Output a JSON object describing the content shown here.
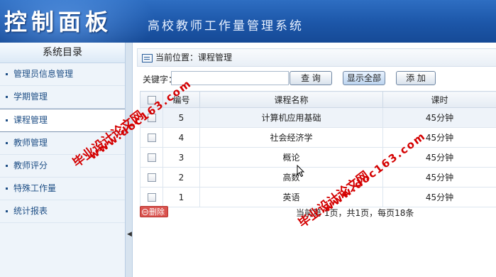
{
  "header": {
    "title": "控制面板",
    "subtitle": "高校教师工作量管理系统"
  },
  "sidebar": {
    "title": "系统目录",
    "items": [
      {
        "label": "管理员信息管理"
      },
      {
        "label": "学期管理"
      },
      {
        "label": "课程管理"
      },
      {
        "label": "教师管理"
      },
      {
        "label": "教师评分"
      },
      {
        "label": "特殊工作量"
      },
      {
        "label": "统计报表"
      }
    ]
  },
  "breadcrumb": {
    "text": "当前位置：课程管理"
  },
  "toolbar": {
    "keyword_label": "关键字：",
    "keyword_value": "",
    "search_label": "查 询",
    "show_all_label": "显示全部",
    "add_label": "添 加"
  },
  "table": {
    "headers": [
      "",
      "编号",
      "课程名称",
      "课时"
    ],
    "rows": [
      {
        "id": "5",
        "name": "计算机应用基础",
        "hours": "45分钟"
      },
      {
        "id": "4",
        "name": "社会经济学",
        "hours": "45分钟"
      },
      {
        "id": "3",
        "name": "概论",
        "hours": "45分钟"
      },
      {
        "id": "2",
        "name": "高数",
        "hours": "45分钟"
      },
      {
        "id": "1",
        "name": "英语",
        "hours": "45分钟"
      }
    ]
  },
  "delete_label": "删除",
  "pager": {
    "text": "当前第 1页，共1页，每页18条"
  },
  "watermarks": {
    "site": "www.doc163.com",
    "cn": "毕业设计论文网"
  },
  "colors": {
    "header": "#1c56a8",
    "watermark": "#d40000",
    "delete": "#d9534f"
  }
}
